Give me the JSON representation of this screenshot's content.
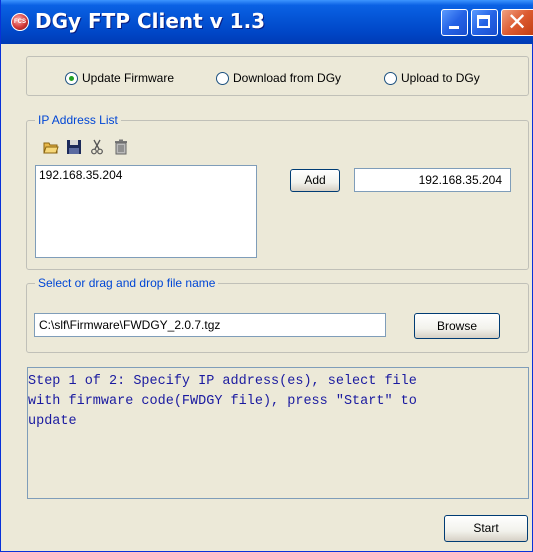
{
  "window": {
    "title": "DGy FTP Client v 1.3",
    "app_icon": "fcs-logo-icon",
    "title_buttons": [
      "minimize-icon",
      "maximize-icon",
      "close-icon"
    ]
  },
  "mode": {
    "options": [
      "Update Firmware",
      "Download from DGy",
      "Upload to DGy"
    ],
    "selected": "Update Firmware"
  },
  "ip_group": {
    "legend": "IP Address List",
    "toolbar_icons": [
      "open-folder-icon",
      "save-disk-icon",
      "cut-scissors-icon",
      "trash-icon"
    ],
    "list_items": [
      "192.168.35.204"
    ],
    "add_label": "Add",
    "ip_value": "192.168.35.204"
  },
  "file_group": {
    "legend": "Select or drag and drop file name",
    "file_value": "C:\\slf\\Firmware\\FWDGY_2.0.7.tgz",
    "browse_label": "Browse"
  },
  "status_lines": [
    "Step 1 of 2: Specify IP address(es), select file",
    "with firmware code(FWDGY file), press \"Start\" to",
    "update"
  ],
  "start_label": "Start",
  "colors": {
    "title_bar": "#0453d4",
    "window_bg": "#ece9d8",
    "group_legend": "#0046d5",
    "status_text": "#1a1aa0",
    "radio_selected": "#21a121"
  }
}
